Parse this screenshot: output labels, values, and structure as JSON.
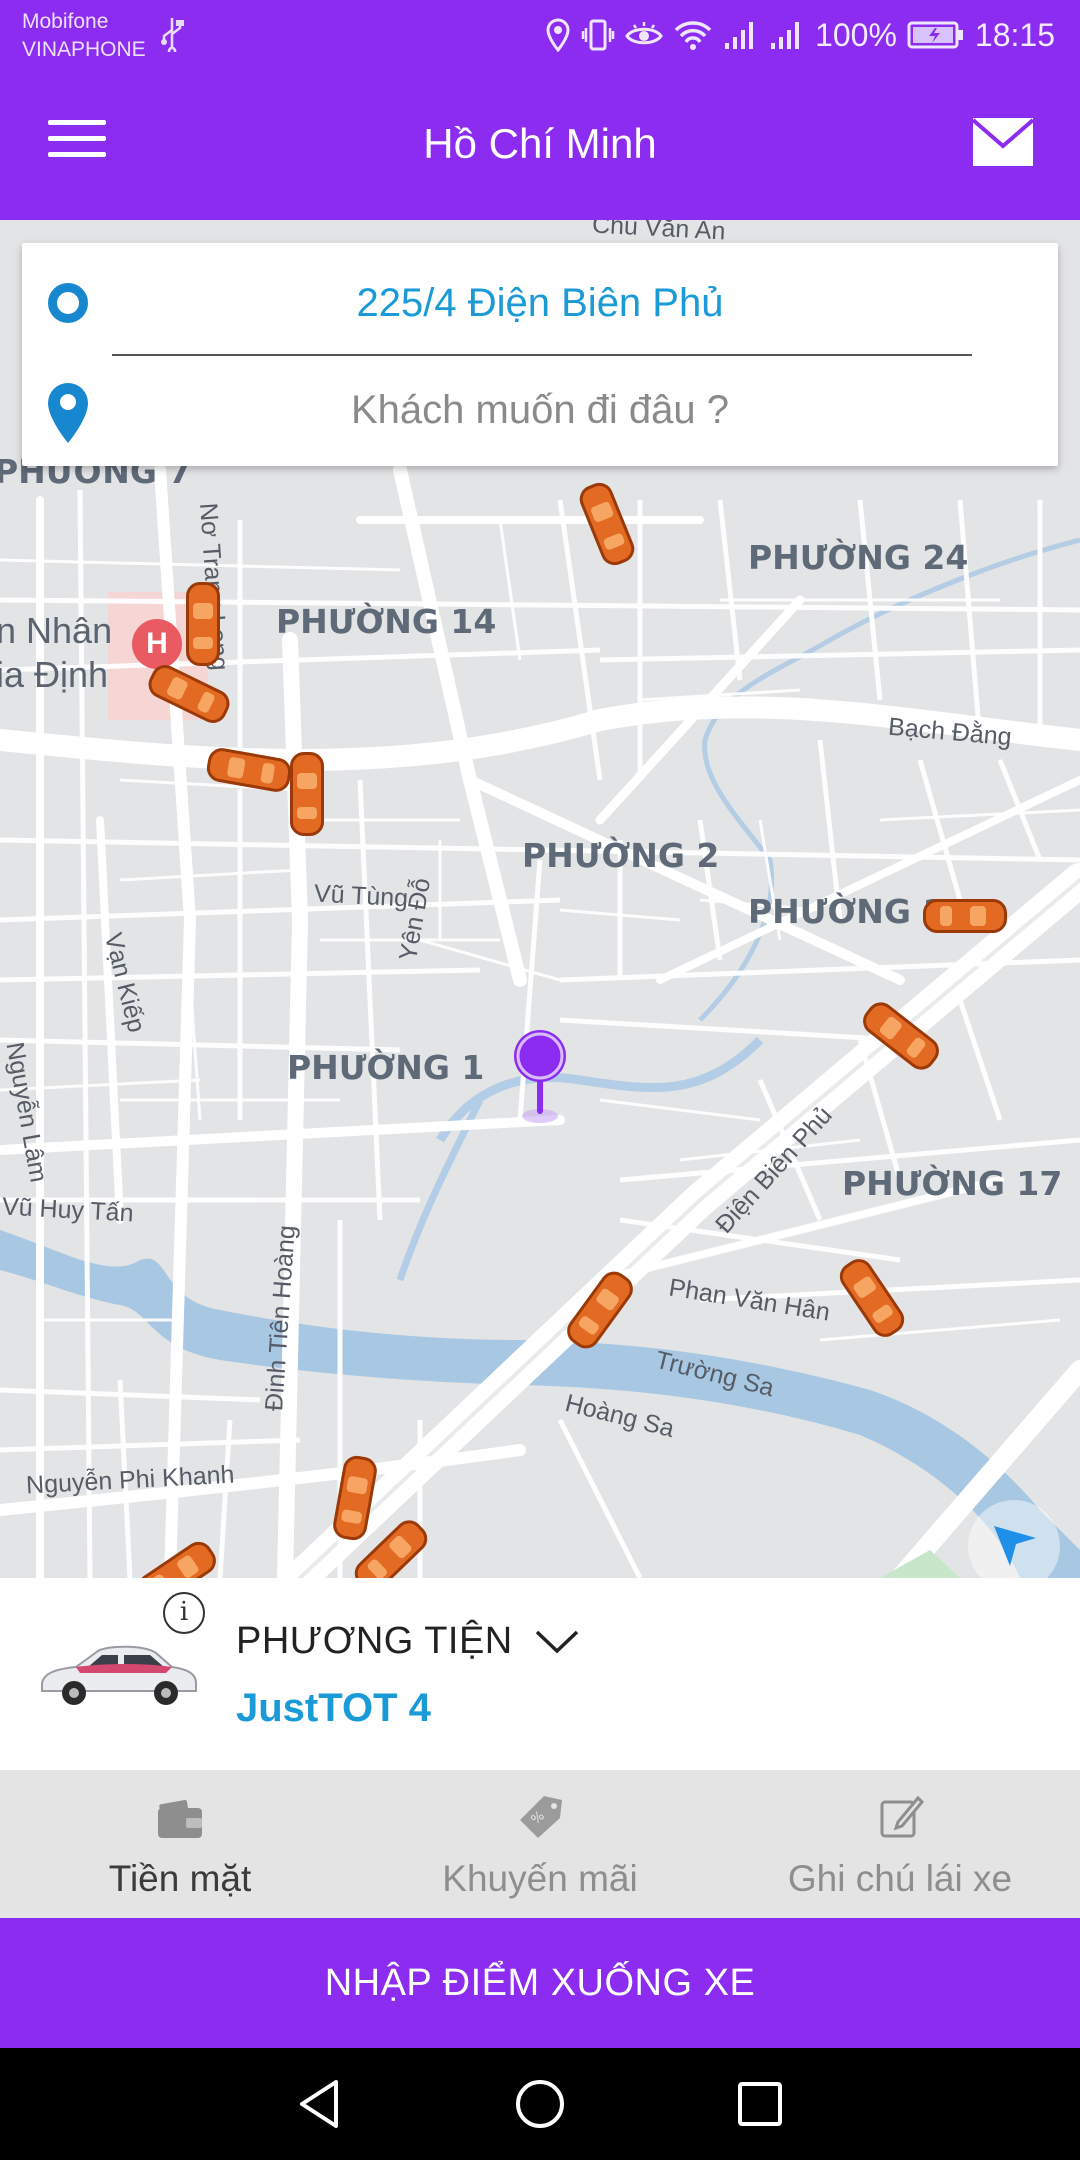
{
  "status_bar": {
    "carrier_1": "Mobifone",
    "carrier_2": "VINAPHONE",
    "battery": "100%",
    "time": "18:15"
  },
  "app_bar": {
    "title": "Hồ Chí Minh",
    "menu_icon": "hamburger-menu-icon",
    "mail_icon": "envelope-icon"
  },
  "search": {
    "pickup": "225/4 Điện Biên Phủ",
    "destination_placeholder": "Khách muốn đi đâu ?"
  },
  "map": {
    "districts": [
      "PHƯỜNG 7",
      "PHƯỜNG 24",
      "PHƯỜNG 14",
      "PHƯỜNG 2",
      "PHƯỜNG 15",
      "PHƯỜNG 1",
      "PHƯỜNG 17"
    ],
    "streets": [
      "Chu Văn An",
      "Bạch Đằng",
      "Vũ Tùng",
      "Yên Đỗ",
      "Nguyễn Lâm",
      "Vạn Kiếp",
      "Vũ Huy Tấn",
      "Đinh Tiên Hoàng",
      "Điện Biên Phủ",
      "Phan Văn Hân",
      "Trường Sa",
      "Hoàng Sa",
      "Nguyễn Phi Khanh",
      "Nơ Trang Long"
    ],
    "hospital_name_1": "n Nhân",
    "hospital_name_2": "ia Định",
    "hospital_marker": "H",
    "accent": "#8c2cf0"
  },
  "vehicle": {
    "header": "PHƯƠNG TIỆN",
    "name": "JustTOT 4",
    "info_icon": "i"
  },
  "options": [
    {
      "label": "Tiền mặt",
      "icon": "wallet-icon"
    },
    {
      "label": "Khuyến mãi",
      "icon": "promo-tag-icon"
    },
    {
      "label": "Ghi chú lái xe",
      "icon": "note-edit-icon"
    }
  ],
  "cta": {
    "label": "NHẬP ĐIỂM XUỐNG XE"
  }
}
